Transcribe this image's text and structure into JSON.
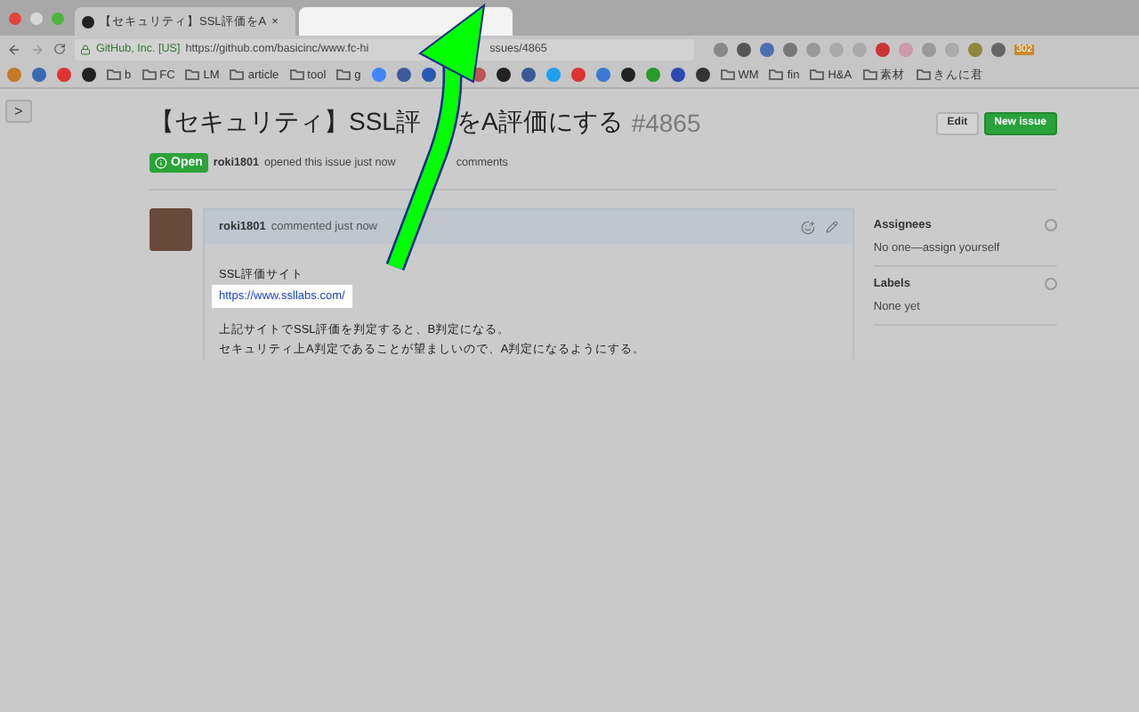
{
  "tabs": [
    {
      "title": "【セキュリティ】SSL評価をA",
      "close": "×",
      "selected": true
    },
    {
      "selected": false,
      "kind": "blank"
    }
  ],
  "address_bar": {
    "security_label": "GitHub, Inc. [US]",
    "url_start": "https://github.com/basicinc/www.fc-hi",
    "url_end": "ssues/4865"
  },
  "bookmarks_left": [
    "b",
    "FC",
    "LM",
    "article",
    "tool",
    "g"
  ],
  "bookmarks_right": [
    "WM",
    "fin",
    "H&A",
    "素材",
    "きんに君"
  ],
  "extension_badge": "302",
  "sidebar_toggle": ">",
  "issue": {
    "title_start": "【セキュリティ】SSL評",
    "title_end": "をA評価にする",
    "number": "#4865",
    "state": "Open",
    "author": "roki1801",
    "meta_start": "opened this issue just now",
    "meta_end": "comments",
    "buttons": [
      "Edit",
      "New issue"
    ]
  },
  "comment": {
    "author": "roki1801",
    "action": "commented just now",
    "lines": [
      "SSL評価サイト"
    ],
    "link": "https://www.ssllabs.com/",
    "paragraph": [
      "上記サイトでSSL評価を判定すると、B判定になる。",
      "セキュリティ上A判定であることが望ましいので、A判定になるようにする。"
    ]
  },
  "sidebar": [
    {
      "heading": "Assignees",
      "value": "No one—assign yourself"
    },
    {
      "heading": "Labels",
      "value": "None yet"
    }
  ]
}
